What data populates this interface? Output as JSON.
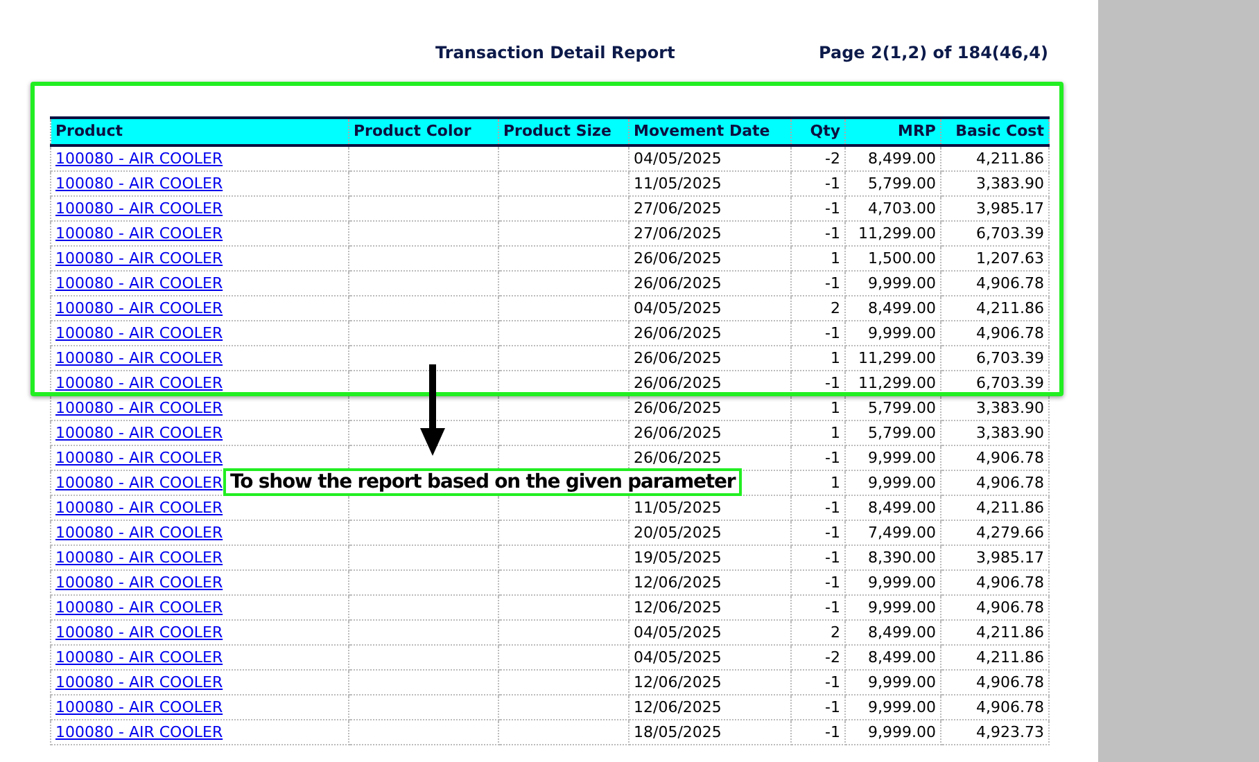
{
  "report": {
    "title": "Transaction Detail Report",
    "page_info": "Page 2(1,2) of 184(46,4)"
  },
  "table": {
    "columns": [
      "Product",
      "Product Color",
      "Product Size",
      "Movement Date",
      "Qty",
      "MRP",
      "Basic Cost"
    ],
    "rows": [
      {
        "product": "100080 - AIR COOLER",
        "date": "04/05/2025",
        "qty": "-2",
        "mrp": "8,499.00",
        "basic_cost": "4,211.86"
      },
      {
        "product": "100080 - AIR COOLER",
        "date": "11/05/2025",
        "qty": "-1",
        "mrp": "5,799.00",
        "basic_cost": "3,383.90"
      },
      {
        "product": "100080 - AIR COOLER",
        "date": "27/06/2025",
        "qty": "-1",
        "mrp": "4,703.00",
        "basic_cost": "3,985.17"
      },
      {
        "product": "100080 - AIR COOLER",
        "date": "27/06/2025",
        "qty": "-1",
        "mrp": "11,299.00",
        "basic_cost": "6,703.39"
      },
      {
        "product": "100080 - AIR COOLER",
        "date": "26/06/2025",
        "qty": "1",
        "mrp": "1,500.00",
        "basic_cost": "1,207.63"
      },
      {
        "product": "100080 - AIR COOLER",
        "date": "26/06/2025",
        "qty": "-1",
        "mrp": "9,999.00",
        "basic_cost": "4,906.78"
      },
      {
        "product": "100080 - AIR COOLER",
        "date": "04/05/2025",
        "qty": "2",
        "mrp": "8,499.00",
        "basic_cost": "4,211.86"
      },
      {
        "product": "100080 - AIR COOLER",
        "date": "26/06/2025",
        "qty": "-1",
        "mrp": "9,999.00",
        "basic_cost": "4,906.78"
      },
      {
        "product": "100080 - AIR COOLER",
        "date": "26/06/2025",
        "qty": "1",
        "mrp": "11,299.00",
        "basic_cost": "6,703.39"
      },
      {
        "product": "100080 - AIR COOLER",
        "date": "26/06/2025",
        "qty": "-1",
        "mrp": "11,299.00",
        "basic_cost": "6,703.39"
      },
      {
        "product": "100080 - AIR COOLER",
        "date": "26/06/2025",
        "qty": "1",
        "mrp": "5,799.00",
        "basic_cost": "3,383.90"
      },
      {
        "product": "100080 - AIR COOLER",
        "date": "26/06/2025",
        "qty": "1",
        "mrp": "5,799.00",
        "basic_cost": "3,383.90"
      },
      {
        "product": "100080 - AIR COOLER",
        "date": "26/06/2025",
        "qty": "-1",
        "mrp": "9,999.00",
        "basic_cost": "4,906.78"
      },
      {
        "product": "100080 - AIR COOLER",
        "qty": "1",
        "mrp": "9,999.00",
        "basic_cost": "4,906.78"
      },
      {
        "product": "100080 - AIR COOLER",
        "date": "11/05/2025",
        "qty": "-1",
        "mrp": "8,499.00",
        "basic_cost": "4,211.86"
      },
      {
        "product": "100080 - AIR COOLER",
        "date": "20/05/2025",
        "qty": "-1",
        "mrp": "7,499.00",
        "basic_cost": "4,279.66"
      },
      {
        "product": "100080 - AIR COOLER",
        "date": "19/05/2025",
        "qty": "-1",
        "mrp": "8,390.00",
        "basic_cost": "3,985.17"
      },
      {
        "product": "100080 - AIR COOLER",
        "date": "12/06/2025",
        "qty": "-1",
        "mrp": "9,999.00",
        "basic_cost": "4,906.78"
      },
      {
        "product": "100080 - AIR COOLER",
        "date": "12/06/2025",
        "qty": "-1",
        "mrp": "9,999.00",
        "basic_cost": "4,906.78"
      },
      {
        "product": "100080 - AIR COOLER",
        "date": "04/05/2025",
        "qty": "2",
        "mrp": "8,499.00",
        "basic_cost": "4,211.86"
      },
      {
        "product": "100080 - AIR COOLER",
        "date": "04/05/2025",
        "qty": "-2",
        "mrp": "8,499.00",
        "basic_cost": "4,211.86"
      },
      {
        "product": "100080 - AIR COOLER",
        "date": "12/06/2025",
        "qty": "-1",
        "mrp": "9,999.00",
        "basic_cost": "4,906.78"
      },
      {
        "product": "100080 - AIR COOLER",
        "date": "12/06/2025",
        "qty": "-1",
        "mrp": "9,999.00",
        "basic_cost": "4,906.78"
      },
      {
        "product": "100080 - AIR COOLER",
        "date": "18/05/2025",
        "qty": "-1",
        "mrp": "9,999.00",
        "basic_cost": "4,923.73"
      }
    ]
  },
  "annotation": {
    "callout": "To show the report based on the given parameter"
  }
}
